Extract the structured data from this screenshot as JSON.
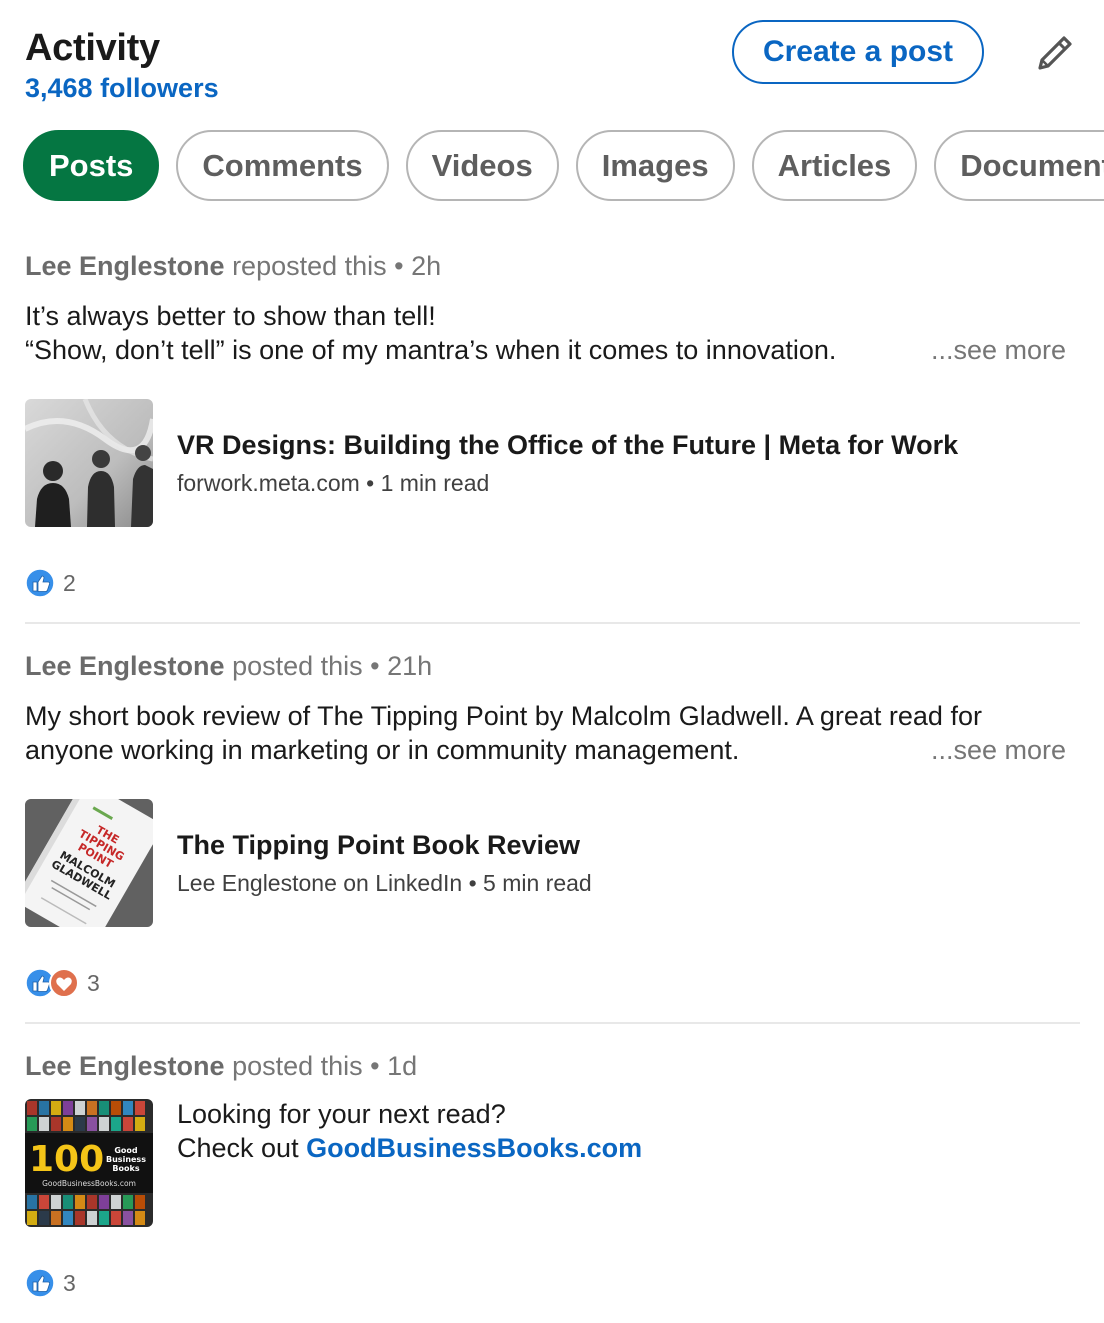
{
  "header": {
    "title": "Activity",
    "followers": "3,468 followers",
    "create_post": "Create a post"
  },
  "filters": [
    "Posts",
    "Comments",
    "Videos",
    "Images",
    "Articles",
    "Document"
  ],
  "posts": [
    {
      "author": "Lee Englestone",
      "action": "reposted this",
      "time": "2h",
      "line1": "It’s always better to show than tell!",
      "line2": "“Show, don’t tell” is one of my mantra’s when it comes to innovation.",
      "see_more": "...see more",
      "attachment_title": "VR Designs: Building the Office of the Future | Meta for Work",
      "attachment_source": "forwork.meta.com",
      "attachment_read": "1 min read",
      "reaction_count": "2"
    },
    {
      "author": "Lee Englestone",
      "action": "posted this",
      "time": "21h",
      "line1": "My short book review of The Tipping Point by Malcolm Gladwell. A great read for",
      "line2": "anyone working in marketing or in community management.",
      "see_more": "...see more",
      "attachment_title": "The Tipping Point Book Review",
      "attachment_source": "Lee Englestone on LinkedIn",
      "attachment_read": "5 min read",
      "book_cover_lines": [
        "THE",
        "TIPPING",
        "POINT",
        "MALCOLM",
        "GLADWELL"
      ],
      "reaction_count": "3"
    },
    {
      "author": "Lee Englestone",
      "action": "posted this",
      "time": "1d",
      "line1": "Looking for your next read?",
      "line2_prefix": "Check out ",
      "link": "GoodBusinessBooks.com",
      "thumb_number": "100",
      "thumb_label_lines": [
        "Good",
        "Business",
        "Books"
      ],
      "thumb_site": "GoodBusinessBooks.com",
      "reaction_count": "3"
    }
  ],
  "separator": "•",
  "colors": {
    "accent": "#0a66c2",
    "active_filter": "#057642",
    "like": "#378fe9",
    "love": "#df704d"
  },
  "icons": {
    "edit": "pencil-icon",
    "like": "like-reaction-icon",
    "love": "love-reaction-icon"
  }
}
